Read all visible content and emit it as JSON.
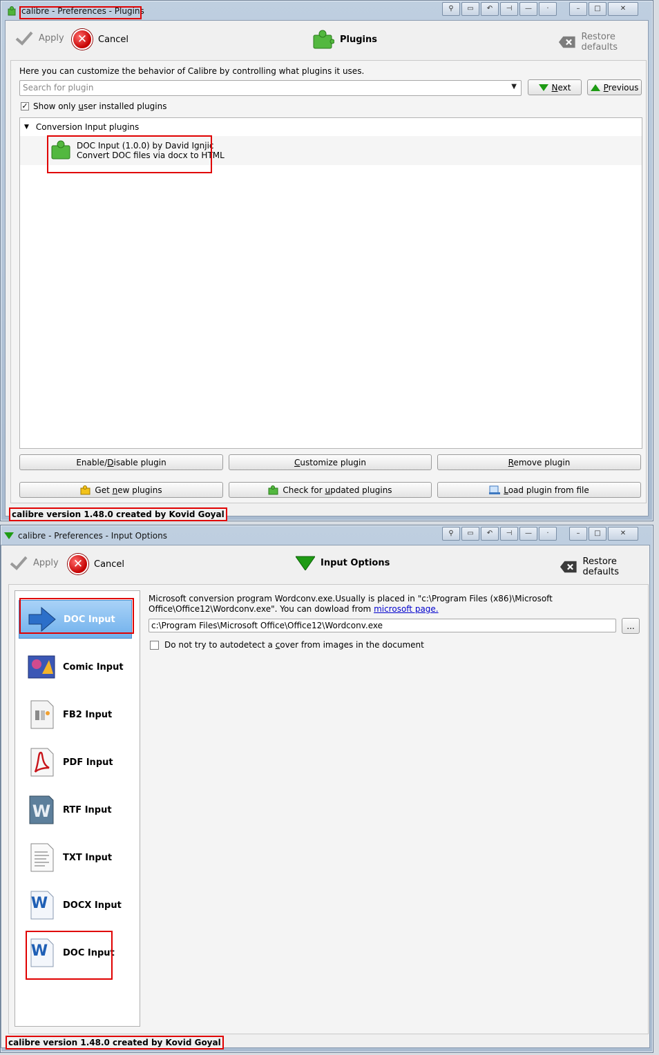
{
  "win1": {
    "title": "calibre - Preferences - Plugins",
    "toolbar": {
      "apply": "Apply",
      "cancel": "Cancel",
      "heading": "Plugins",
      "restore": "Restore defaults"
    },
    "description": "Here you can customize the behavior of Calibre by controlling what plugins it uses.",
    "search": {
      "placeholder": "Search for plugin"
    },
    "next_pre": "",
    "next_key": "N",
    "next_rest": "ext",
    "prev_pre": "",
    "prev_key": "P",
    "prev_rest": "revious",
    "show_only_pre": "Show only ",
    "show_only_key": "u",
    "show_only_rest": "ser installed plugins",
    "tree": {
      "group": "Conversion Input plugins",
      "plugin_line1": "DOC Input (1.0.0) by David Ignjic",
      "plugin_line2": "Convert DOC files via docx to HTML"
    },
    "buttons": {
      "enable_pre": "Enable/",
      "enable_key": "D",
      "enable_rest": "isable plugin",
      "customize_pre": "",
      "customize_key": "C",
      "customize_rest": "ustomize plugin",
      "remove_pre": "",
      "remove_key": "R",
      "remove_rest": "emove plugin",
      "getnew_pre": "Get ",
      "getnew_key": "n",
      "getnew_rest": "ew plugins",
      "check_pre": "Check for ",
      "check_key": "u",
      "check_rest": "pdated plugins",
      "load_pre": "",
      "load_key": "L",
      "load_rest": "oad plugin from file"
    },
    "status": "calibre version 1.48.0 created by Kovid Goyal"
  },
  "win2": {
    "title": "calibre - Preferences - Input Options",
    "toolbar": {
      "apply": "Apply",
      "cancel": "Cancel",
      "heading": "Input Options",
      "restore": "Restore defaults"
    },
    "sidebar": [
      {
        "label": "DOC Input",
        "icon": "arrow-right-icon"
      },
      {
        "label": "Comic Input",
        "icon": "comic-icon"
      },
      {
        "label": "FB2 Input",
        "icon": "fb2-document-icon"
      },
      {
        "label": "PDF Input",
        "icon": "pdf-icon"
      },
      {
        "label": "RTF Input",
        "icon": "rtf-word-icon"
      },
      {
        "label": "TXT Input",
        "icon": "txt-document-icon"
      },
      {
        "label": "DOCX Input",
        "icon": "docx-word-icon"
      },
      {
        "label": "DOC Input",
        "icon": "doc-word-icon"
      }
    ],
    "info_line1": "Microsoft conversion program Wordconv.exe.Usually is placed in \"c:\\Program Files (x86)\\Microsoft",
    "info_line2": "Office\\Office12\\Wordconv.exe\". You can dowload from ",
    "info_link": "microsoft page.",
    "path_value": "c:\\Program Files\\Microsoft Office\\Office12\\Wordconv.exe",
    "browse": "...",
    "cover_pre": "Do not try to autodetect a ",
    "cover_key": "c",
    "cover_rest": "over from images in the document",
    "status": "calibre version 1.48.0 created by Kovid Goyal"
  },
  "colors": {
    "highlight": "#e00000",
    "selection": "#6fb0ec",
    "link": "#0000cc"
  }
}
